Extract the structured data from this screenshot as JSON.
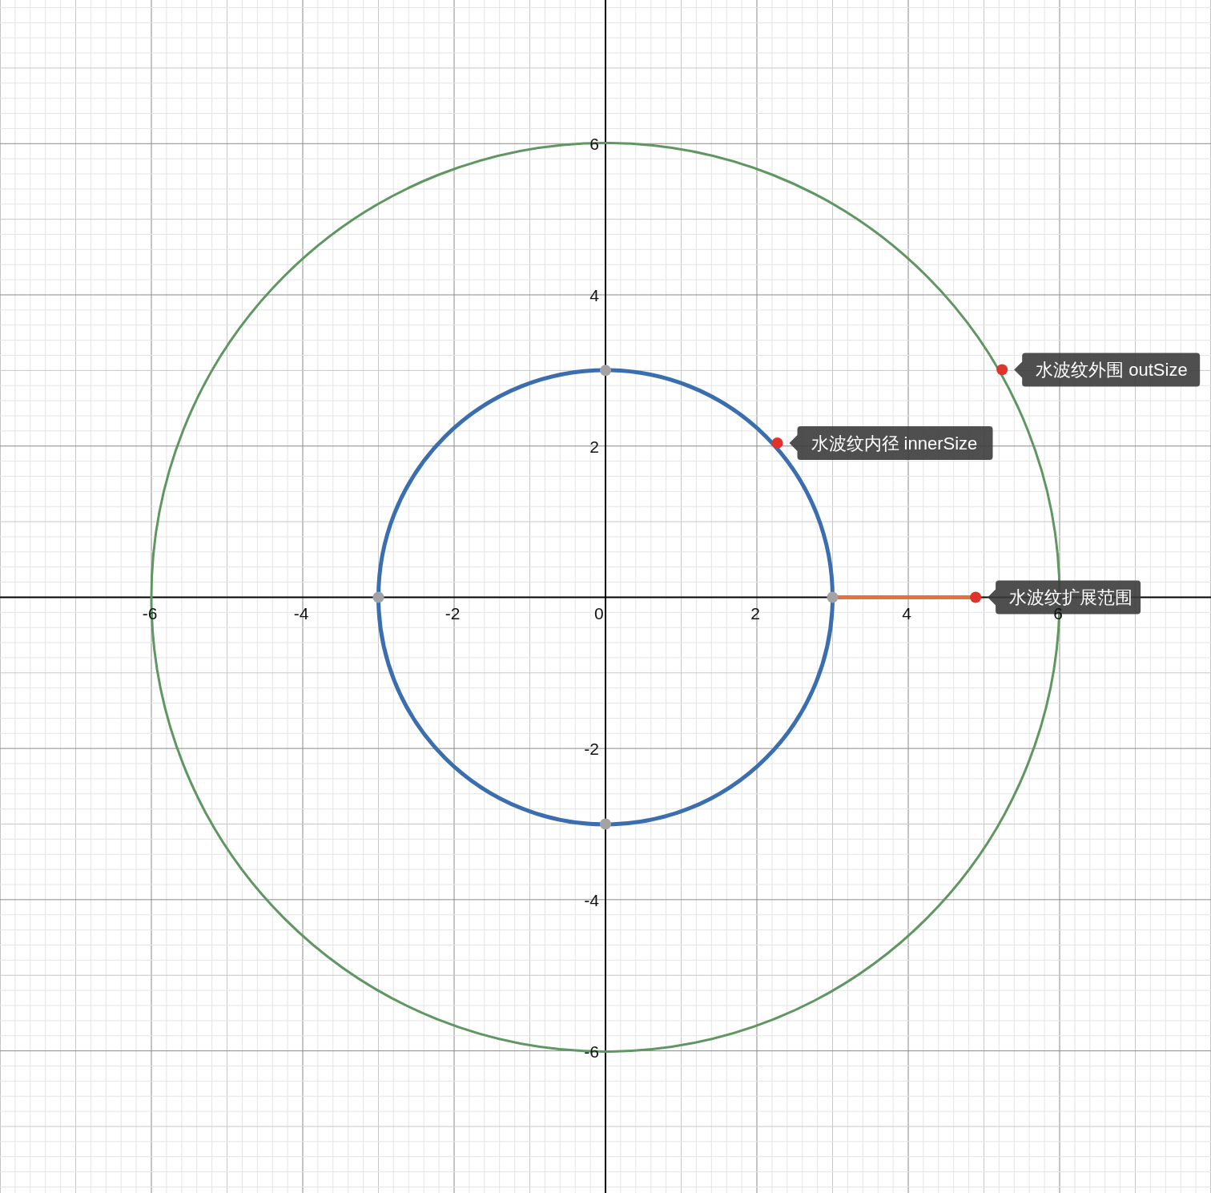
{
  "graph": {
    "chart_data": {
      "type": "line",
      "xlim": [
        -8,
        8
      ],
      "ylim": [
        -7.88,
        7.9
      ],
      "grid": true,
      "xticks": [
        -6,
        -4,
        -2,
        0,
        2,
        4,
        6
      ],
      "yticks": [
        -6,
        -4,
        -2,
        2,
        4,
        6
      ],
      "series": [
        {
          "color": "#e8703f",
          "x": [
            3,
            4.89
          ],
          "values": [
            0,
            0
          ]
        },
        {
          "type": "scatter",
          "color": "#a3a3a3",
          "x": [
            3,
            0,
            -3,
            0
          ],
          "values": [
            0,
            3,
            0,
            -3
          ]
        }
      ],
      "annotations": [
        {
          "text": "水波纹内径 innerSize",
          "x": 2.27,
          "y": 2.04
        },
        {
          "text": "水波纹外围 outSize",
          "x": 5.24,
          "y": 3.01
        },
        {
          "text": "水波纹扩展范围",
          "x": 4.89,
          "y": 0
        }
      ]
    }
  }
}
